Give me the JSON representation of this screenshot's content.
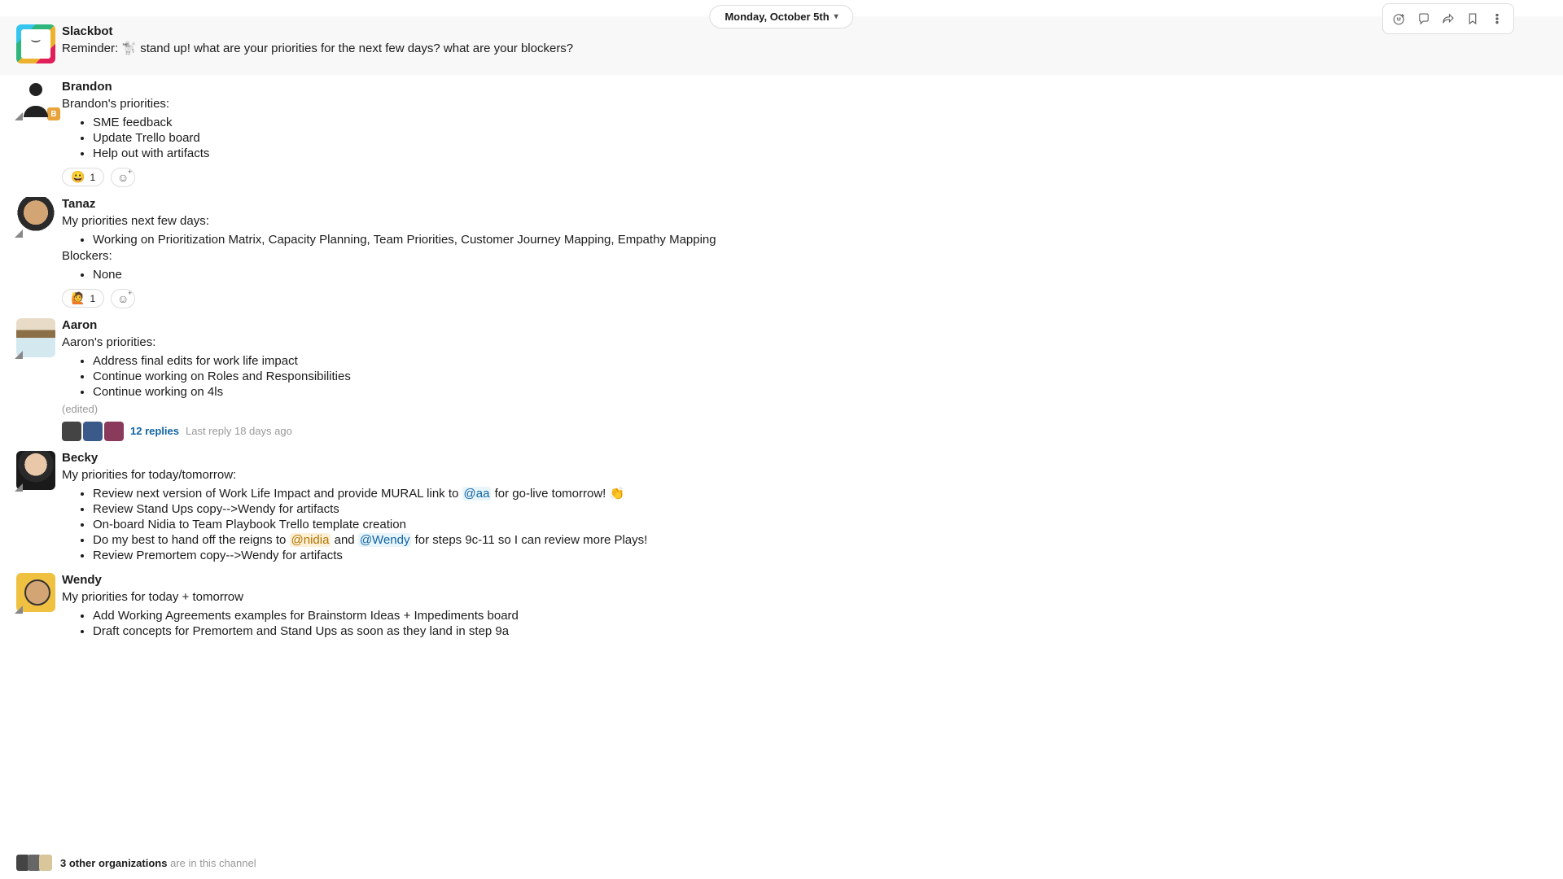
{
  "date_label": "Monday, October 5th",
  "actions": [
    "add-reaction",
    "start-thread",
    "share",
    "bookmark",
    "more"
  ],
  "messages": [
    {
      "author": "Slackbot",
      "avatar": "slackbot",
      "is_bot": true,
      "body_prefix": "Reminder: ",
      "emoji_token": "🐩",
      "body_rest": " stand up! what are your priorities for the next few days? what are your blockers?"
    },
    {
      "author": "Brandon",
      "avatar": "brandon",
      "intro": "Brandon's priorities:",
      "bullets": [
        "SME feedback",
        "Update Trello board",
        "Help out with artifacts"
      ],
      "reactions": [
        {
          "emoji": "😀",
          "count": 1
        }
      ],
      "badge": "B"
    },
    {
      "author": "Tanaz",
      "avatar": "tanaz",
      "intro": "My priorities next few days:",
      "bullets": [
        "Working on Prioritization Matrix, Capacity Planning, Team Priorities, Customer Journey Mapping, Empathy Mapping"
      ],
      "intro2": "Blockers:",
      "bullets2": [
        "None"
      ],
      "reactions": [
        {
          "emoji": "🙋",
          "count": 1
        }
      ]
    },
    {
      "author": "Aaron",
      "avatar": "aaron",
      "intro": "Aaron's priorities:",
      "bullets": [
        "Address final edits for work life impact",
        "Continue working on Roles and Responsibilities",
        "Continue working on 4ls"
      ],
      "edited": "(edited)",
      "thread": {
        "replies": "12 replies",
        "last": "Last reply 18 days ago"
      }
    },
    {
      "author": "Becky",
      "avatar": "becky",
      "intro": "My priorities for today/tomorrow:",
      "bullets_rich": [
        {
          "pre": "Review next version of Work Life Impact and provide MURAL link to ",
          "mention": "@aa",
          "mclass": "",
          "post": " for go-live tomorrow! ",
          "emoji": "👏"
        },
        {
          "text": "Review Stand Ups copy-->Wendy for artifacts"
        },
        {
          "text": "On-board Nidia to Team Playbook Trello template creation"
        },
        {
          "pre": "Do my best to hand off the reigns to ",
          "mention": "@nidia",
          "mclass": "peach",
          "mid": " and ",
          "mention2": "@Wendy",
          "m2class": "",
          "post": " for steps 9c-11 so I can review more Plays!"
        },
        {
          "text": "Review Premortem copy-->Wendy for artifacts"
        }
      ]
    },
    {
      "author": "Wendy",
      "avatar": "wendy",
      "intro": "My priorities for today + tomorrow",
      "bullets": [
        "Add Working Agreements examples for Brainstorm Ideas + Impediments board",
        "Draft concepts for Premortem and Stand Ups as soon as they land in step 9a"
      ]
    }
  ],
  "footer": {
    "bold": "3 other organizations",
    "rest": " are in this channel"
  }
}
